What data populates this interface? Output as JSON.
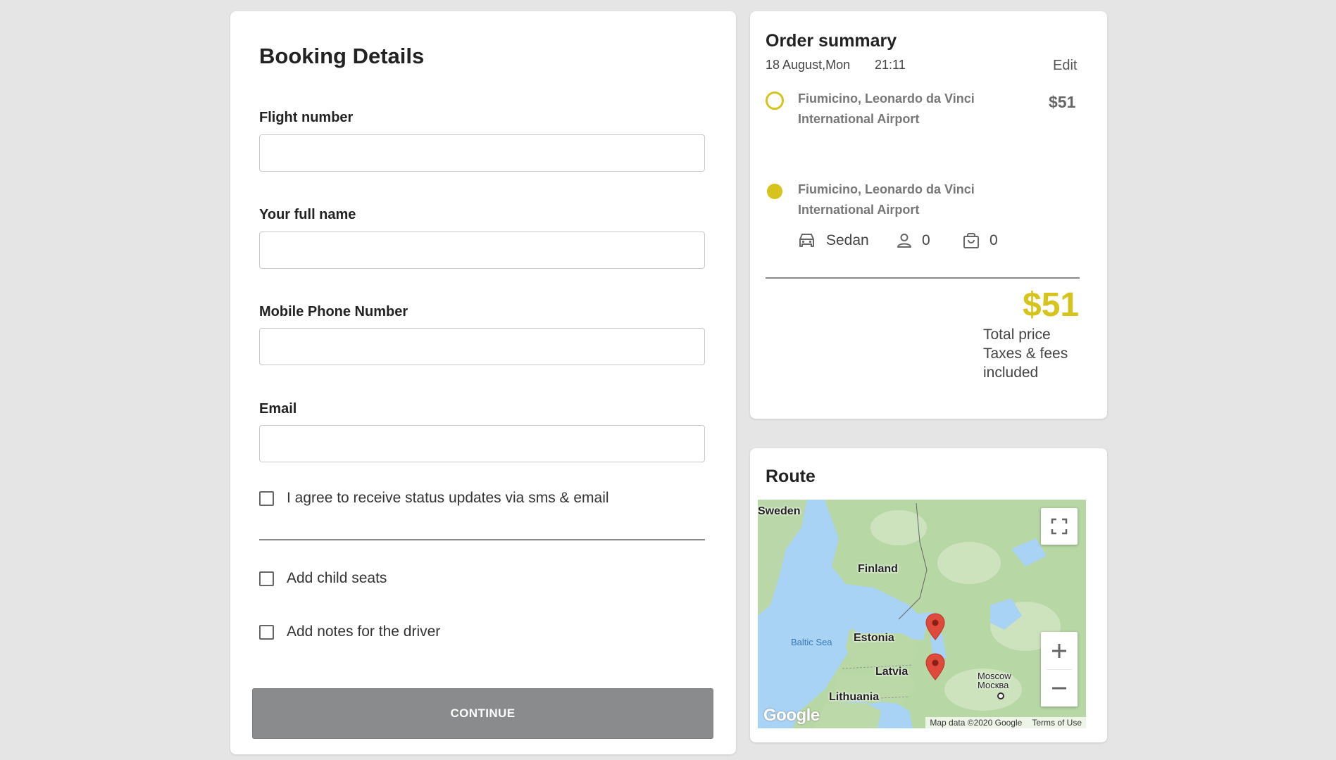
{
  "booking": {
    "title": "Booking Details",
    "fields": [
      {
        "label": "Flight number",
        "value": "",
        "placeholder": ""
      },
      {
        "label": "Your full name",
        "value": "",
        "placeholder": ""
      },
      {
        "label": "Mobile Phone Number",
        "value": "",
        "placeholder": ""
      },
      {
        "label": "Email",
        "value": "",
        "placeholder": ""
      }
    ],
    "agree_label": "I agree to receive status updates via sms & email",
    "child_seats_label": "Add child seats",
    "notes_label": "Add notes for the driver",
    "continue_label": "CONTINUE"
  },
  "summary": {
    "title": "Order summary",
    "date": "18 August,Mon",
    "time": "21:11",
    "edit_label": "Edit",
    "pickup": "Fiumicino, Leonardo da Vinci International Airport",
    "dropoff": "Fiumicino, Leonardo da Vinci International Airport",
    "leg_price": "$51",
    "vehicle": "Sedan",
    "passengers": "0",
    "luggage": "0",
    "total": "$51",
    "total_note": [
      "Total price",
      "Taxes & fees",
      "included"
    ],
    "accent_color": "#d6c31c"
  },
  "route": {
    "title": "Route",
    "map": {
      "labels": {
        "sweden": "Sweden",
        "finland": "Finland",
        "baltic": "Baltic Sea",
        "estonia": "Estonia",
        "latvia": "Latvia",
        "lithuania": "Lithuania",
        "moscow": "Moscow",
        "moscow_ru": "Москва"
      },
      "attribution": "Map data ©2020 Google",
      "terms": "Terms of Use",
      "logo": "Google",
      "controls": [
        "fullscreen-icon",
        "zoom-in-icon",
        "zoom-out-icon"
      ]
    }
  }
}
